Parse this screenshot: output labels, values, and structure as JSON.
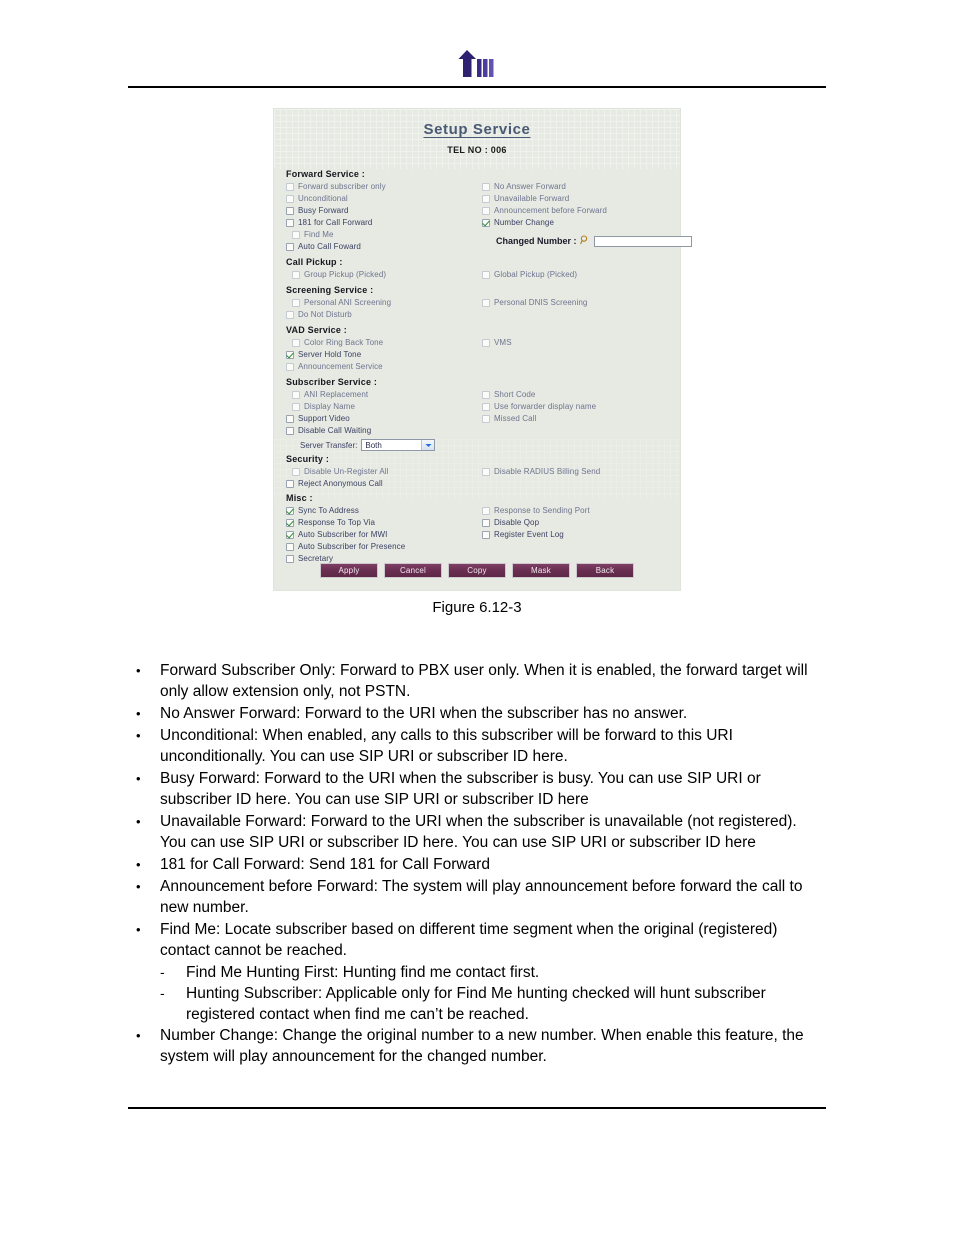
{
  "header": {
    "logo_name": "tw-company-logo"
  },
  "app": {
    "title": "Setup Service",
    "subtitle": "TEL NO : 006",
    "sections": {
      "forward": {
        "title": "Forward Service :",
        "left": [
          {
            "label": "Forward subscriber only",
            "checked": false
          },
          {
            "label": "Unconditional",
            "checked": false
          },
          {
            "label": "Busy Forward",
            "checked": false
          },
          {
            "label": "181 for Call Forward",
            "checked": false
          },
          {
            "label": "Find Me",
            "checked": false
          },
          {
            "label": "Auto Call Foward",
            "checked": false
          }
        ],
        "right": [
          {
            "label": "No Answer Forward",
            "checked": false
          },
          {
            "label": "Unavailable Forward",
            "checked": false
          },
          {
            "label": "Announcement before Forward",
            "checked": false
          },
          {
            "label": "Number Change",
            "checked": true
          }
        ],
        "changed_number_label": "Changed Number :",
        "changed_number_value": "",
        "changed_number_icon": "magnifier-icon"
      },
      "call_pickup": {
        "title": "Call Pickup :",
        "left": [
          {
            "label": "Group Pickup (Picked)",
            "checked": false
          }
        ],
        "right": [
          {
            "label": "Global Pickup (Picked)",
            "checked": false
          }
        ]
      },
      "screening": {
        "title": "Screening Service :",
        "left": [
          {
            "label": "Personal ANI Screening",
            "checked": false
          },
          {
            "label": "Do Not Disturb",
            "checked": false
          }
        ],
        "right": [
          {
            "label": "Personal DNIS Screening",
            "checked": false
          }
        ]
      },
      "vad": {
        "title": "VAD Service :",
        "left": [
          {
            "label": "Color Ring Back Tone",
            "checked": false
          },
          {
            "label": "Server Hold Tone",
            "checked": true
          },
          {
            "label": "Announcement Service",
            "checked": false
          }
        ],
        "right": [
          {
            "label": "VMS",
            "checked": false
          }
        ]
      },
      "subscriber": {
        "title": "Subscriber Service :",
        "left": [
          {
            "label": "ANI Replacement",
            "checked": false
          },
          {
            "label": "Display Name",
            "checked": false
          },
          {
            "label": "Support Video",
            "checked": false
          },
          {
            "label": "Disable Call Waiting",
            "checked": false
          }
        ],
        "right": [
          {
            "label": "Short Code",
            "checked": false
          },
          {
            "label": "Use forwarder display name",
            "checked": false
          },
          {
            "label": "Missed Call",
            "checked": false
          }
        ],
        "server_transfer_label": "Server Transfer:",
        "server_transfer_value": "Both",
        "server_transfer_icon": "chevron-down-icon"
      },
      "security": {
        "title": "Security :",
        "left": [
          {
            "label": "Disable Un-Register All",
            "checked": false
          },
          {
            "label": "Reject Anonymous Call",
            "checked": false
          }
        ],
        "right": [
          {
            "label": "Disable RADIUS Billing Send",
            "checked": false
          }
        ]
      },
      "misc": {
        "title": "Misc :",
        "left": [
          {
            "label": "Sync To Address",
            "checked": true
          },
          {
            "label": "Response To Top Via",
            "checked": true
          },
          {
            "label": "Auto Subscriber for MWI",
            "checked": true
          },
          {
            "label": "Auto Subscriber for Presence",
            "checked": false
          },
          {
            "label": "Secretary",
            "checked": false
          }
        ],
        "right": [
          {
            "label": "Response to Sending Port",
            "checked": false
          },
          {
            "label": "Disable Qop",
            "checked": false
          },
          {
            "label": "Register Event Log",
            "checked": false
          }
        ]
      }
    },
    "buttons": [
      {
        "label": "Apply"
      },
      {
        "label": "Cancel"
      },
      {
        "label": "Copy"
      },
      {
        "label": "Mask"
      },
      {
        "label": "Back"
      }
    ],
    "colors": {
      "panel_bg": "#e6eae2",
      "title": "#4a5a74",
      "label": "#3a3f63",
      "button": "#6b2f53",
      "check": "#2e8b35"
    }
  },
  "figure": {
    "caption": "Figure 6.12-3"
  },
  "prose": {
    "bullet_mark": "•",
    "sub_mark": "-",
    "items": [
      {
        "text": "Forward Subscriber Only: Forward to PBX user only. When it is enabled, the forward target will only allow extension only, not PSTN."
      },
      {
        "text": "No Answer Forward: Forward to the URI when the subscriber has no answer."
      },
      {
        "text": "Unconditional: When enabled, any calls to this subscriber will be forward to this URI unconditionally. You can use SIP URI or subscriber ID here."
      },
      {
        "text": "Busy Forward: Forward to the URI when the subscriber is busy. You can use SIP URI or subscriber ID here. You can use SIP URI or subscriber ID here"
      },
      {
        "text": "Unavailable Forward: Forward to the URI when the subscriber is unavailable (not registered). You can use SIP URI or subscriber ID here. You can use SIP URI or subscriber ID here"
      },
      {
        "text": "181 for Call Forward: Send 181 for Call Forward"
      },
      {
        "text": "Announcement before Forward: The system will play announcement before forward the call to new number."
      },
      {
        "text": "Find Me: Locate subscriber based on different time segment when the original (registered) contact cannot be reached.",
        "subs": [
          "Find Me Hunting First: Hunting find me contact first.",
          "Hunting Subscriber: Applicable only for Find Me hunting checked will hunt subscriber registered contact when find me can’t be reached."
        ]
      },
      {
        "text": "Number Change: Change the original number to a new number. When enable this feature, the system will play announcement for the changed number."
      }
    ]
  }
}
